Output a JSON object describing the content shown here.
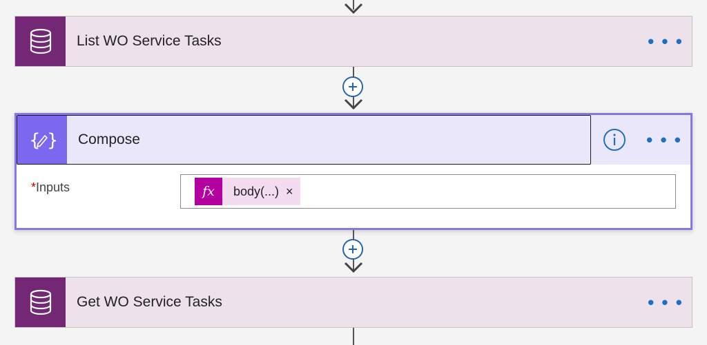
{
  "flow": {
    "step1": {
      "title": "List WO Service Tasks",
      "icon": "database-icon",
      "more_label": "• • •"
    },
    "step2": {
      "title": "Compose",
      "icon": "compose-icon",
      "info_icon": "info-icon",
      "more_label": "• • •",
      "inputs_label": "Inputs",
      "required_marker": "*",
      "token": {
        "fx_label": "fx",
        "text": "body(...)",
        "remove": "×"
      }
    },
    "step3": {
      "title": "Get WO Service Tasks",
      "icon": "database-icon",
      "more_label": "• • •"
    }
  },
  "colors": {
    "dataverse_tile": "#742774",
    "dataverse_card": "#ede1ec",
    "compose_tile": "#7b68ee",
    "compose_border": "#8a76e3",
    "accent_blue": "#1e6fc0",
    "expression_token": "#b4009e"
  }
}
